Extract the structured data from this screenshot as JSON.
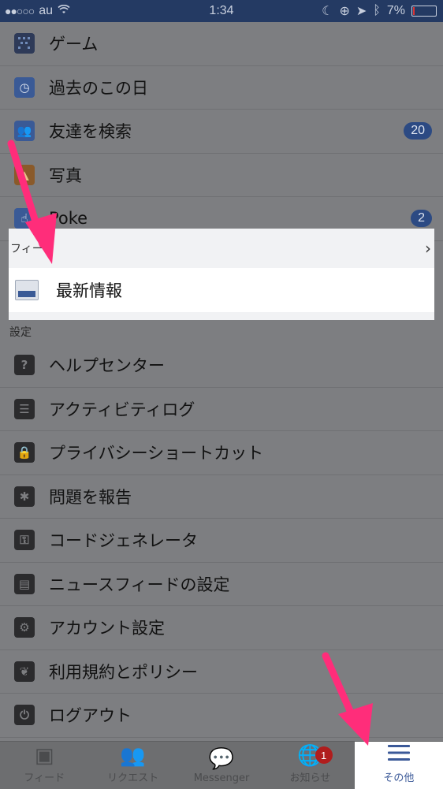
{
  "status_bar": {
    "signal": "●●○○○",
    "carrier": "au",
    "time": "1:34",
    "battery": "7%"
  },
  "apps": [
    {
      "label": "ゲーム",
      "icon": "grid-icon",
      "color": "#2e3a58"
    },
    {
      "label": "過去のこの日",
      "icon": "clock-history-icon",
      "color": "#3a5a96"
    },
    {
      "label": "友達を検索",
      "icon": "friends-icon",
      "color": "#3a5a96",
      "badge": "20"
    },
    {
      "label": "写真",
      "icon": "photo-icon",
      "color": "#8a5a2a"
    },
    {
      "label": "Poke",
      "icon": "poke-hand-icon",
      "color": "#3a5a96",
      "badge": "2"
    }
  ],
  "feed_section": {
    "header": "フィード",
    "latest_label": "最新情報"
  },
  "settings_section": {
    "header": "設定",
    "items": [
      {
        "label": "ヘルプセンター",
        "icon": "help-icon"
      },
      {
        "label": "アクティビティログ",
        "icon": "list-icon"
      },
      {
        "label": "プライバシーショートカット",
        "icon": "privacy-lock-icon"
      },
      {
        "label": "問題を報告",
        "icon": "bug-icon"
      },
      {
        "label": "コードジェネレータ",
        "icon": "code-lock-icon"
      },
      {
        "label": "ニュースフィードの設定",
        "icon": "feed-settings-icon"
      },
      {
        "label": "アカウント設定",
        "icon": "gear-icon"
      },
      {
        "label": "利用規約とポリシー",
        "icon": "policy-icon"
      },
      {
        "label": "ログアウト",
        "icon": "power-icon"
      }
    ]
  },
  "tab_bar": {
    "tabs": [
      {
        "label": "フィード",
        "icon": "news-feed-icon"
      },
      {
        "label": "リクエスト",
        "icon": "friend-requests-icon"
      },
      {
        "label": "Messenger",
        "icon": "messenger-icon"
      },
      {
        "label": "お知らせ",
        "icon": "globe-icon",
        "badge": "1"
      },
      {
        "label": "その他",
        "icon": "menu-icon"
      }
    ]
  },
  "colors": {
    "accent": "#3b5998",
    "overlay": "#7d7e81",
    "arrow": "#ff2d7a"
  }
}
